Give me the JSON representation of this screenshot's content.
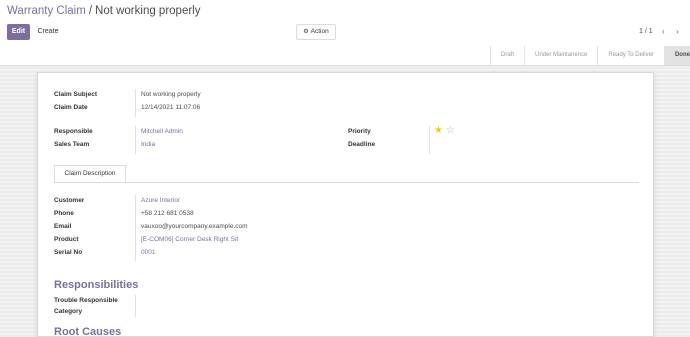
{
  "breadcrumb": {
    "parent": "Warranty Claim",
    "separator": "/",
    "current": "Not working properly"
  },
  "toolbar": {
    "edit_label": "Edit",
    "create_label": "Create",
    "action_label": "Action"
  },
  "pager": {
    "value": "1 / 1"
  },
  "stages": [
    "Draft",
    "Under Maintanence",
    "Ready To Deliver",
    "Done"
  ],
  "active_stage": "Done",
  "form": {
    "claim_subject_label": "Claim Subject",
    "claim_subject_value": "Not working properly",
    "claim_date_label": "Claim Date",
    "claim_date_value": "12/14/2021 11:07:06",
    "responsible_label": "Responsible",
    "responsible_value": "Mitchell Admin",
    "sales_team_label": "Sales Team",
    "sales_team_value": "India",
    "priority_label": "Priority",
    "priority_stars": 1,
    "priority_max": 2,
    "deadline_label": "Deadline",
    "tab_label": "Claim Description",
    "customer_label": "Customer",
    "customer_value": "Azure Interior",
    "phone_label": "Phone",
    "phone_value": "+58 212 681 0538",
    "email_label": "Email",
    "email_value": "vauxoo@yourcompany.example.com",
    "product_label": "Product",
    "product_value": "[E-COM06] Corner Desk Right Sit",
    "serial_label": "Serial No",
    "serial_value": "0001",
    "responsibilities_title": "Responsibilities",
    "trouble_label_1": "Trouble Responsible",
    "trouble_label_2": "Category",
    "root_causes_title": "Root Causes"
  },
  "colors": {
    "accent": "#7c6f9e",
    "star_on": "#f3cc00",
    "star_off": "#b7b7b7"
  }
}
